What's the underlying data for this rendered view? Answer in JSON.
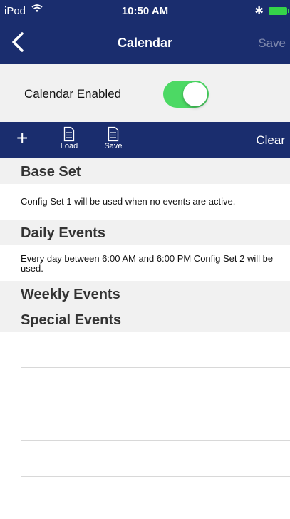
{
  "status_bar": {
    "carrier": "iPod",
    "time": "10:50 AM"
  },
  "nav": {
    "title": "Calendar",
    "save_label": "Save"
  },
  "toggle": {
    "label": "Calendar Enabled",
    "enabled": true
  },
  "toolbar": {
    "load_label": "Load",
    "save_label": "Save",
    "clear_label": "Clear"
  },
  "sections": {
    "base_set": {
      "title": "Base Set",
      "description": "Config Set 1 will be used when no events are active."
    },
    "daily_events": {
      "title": "Daily Events",
      "description": "Every day between 6:00 AM and 6:00 PM Config Set 2 will be used."
    },
    "weekly_events": {
      "title": "Weekly Events"
    },
    "special_events": {
      "title": "Special Events"
    }
  },
  "colors": {
    "nav_bg": "#1a2d6e",
    "toggle_on": "#4cd964",
    "section_bg": "#f1f1f1"
  }
}
